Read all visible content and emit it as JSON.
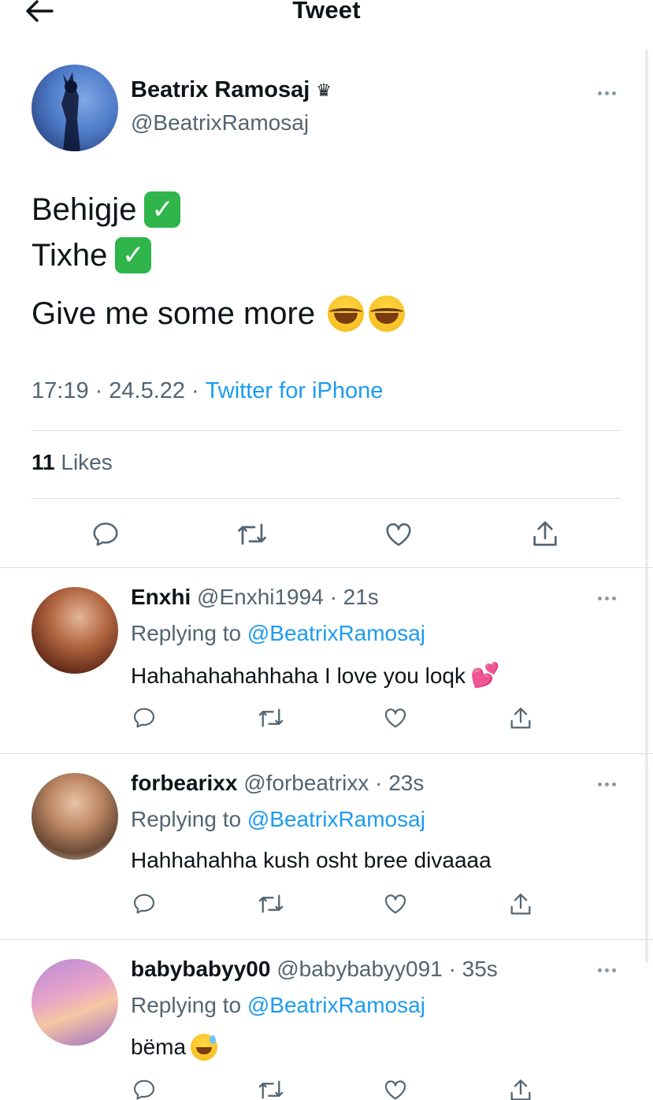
{
  "header": {
    "title": "Tweet",
    "back_icon": "arrow-left-icon"
  },
  "main_tweet": {
    "author_name": "Beatrix Ramosaj",
    "author_badge": "♛",
    "author_handle": "@BeatrixRamosaj",
    "lines": [
      {
        "text": "Behigje",
        "emoji": "white-check-mark"
      },
      {
        "text": "Tixhe",
        "emoji": "white-check-mark"
      },
      {
        "text": "Give me some more",
        "emoji": "face-with-tears-of-joy x2"
      }
    ],
    "time": "17:19",
    "date": "24.5.22",
    "source": "Twitter for iPhone",
    "separator": "·",
    "likes_count": "11",
    "likes_label": "Likes",
    "check_glyph": "✓"
  },
  "replies": [
    {
      "name": "Enxhi",
      "handle": "@Enxhi1994",
      "time": "· 21s",
      "replying_prefix": "Replying to",
      "replying_to": "@BeatrixRamosaj",
      "text": "Hahahahahahhaha I love you loqk",
      "emoji": "💕"
    },
    {
      "name": "forbearixx",
      "handle": "@forbeatrixx",
      "time": "· 23s",
      "replying_prefix": "Replying to",
      "replying_to": "@BeatrixRamosaj",
      "text": "Hahhahahha kush osht bree divaaaa"
    },
    {
      "name": "babybabyy00",
      "handle": "@babybabyy091",
      "time": "· 35s",
      "replying_prefix": "Replying to",
      "replying_to": "@BeatrixRamosaj",
      "text": "bëma"
    }
  ],
  "actions": [
    "reply-icon",
    "retweet-icon",
    "like-icon",
    "share-icon"
  ],
  "colors": {
    "link": "#1d9bf0",
    "secondary_text": "#536471",
    "divider": "#d7dee3",
    "icon": "#536471",
    "check_green": "#2fb54a"
  }
}
